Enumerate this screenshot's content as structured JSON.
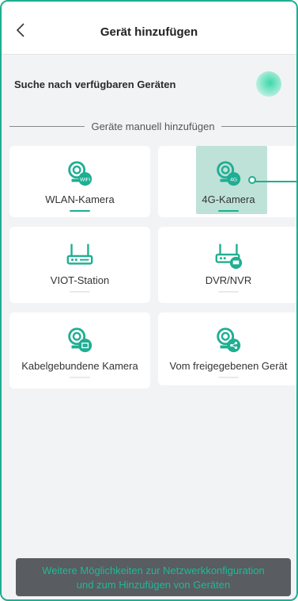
{
  "header": {
    "back_icon": "chevron-left-icon",
    "title": "Gerät hinzufügen"
  },
  "search": {
    "label": "Suche nach verfügbaren Geräten",
    "status_icon": "radar-scan-icon"
  },
  "section": {
    "divider_label": "Geräte manuell hinzufügen"
  },
  "devices": [
    {
      "label": "WLAN-Kamera",
      "icon": "wifi-camera-icon"
    },
    {
      "label": "4G-Kamera",
      "icon": "4g-camera-icon",
      "highlighted": true
    },
    {
      "label": "VIOT-Station",
      "icon": "station-icon"
    },
    {
      "label": "DVR/NVR",
      "icon": "dvr-nvr-icon"
    },
    {
      "label": "Kabelgebundene Kamera",
      "icon": "wired-camera-icon"
    },
    {
      "label": "Vom freigegebenen Gerät",
      "icon": "shared-camera-icon"
    }
  ],
  "footer": {
    "line1": "Weitere Möglichkeiten zur Netzwerkkonfiguration",
    "line2": "und zum Hinzufügen von Geräten"
  },
  "colors": {
    "accent": "#1fae92",
    "background": "#f2f3f5",
    "footer_bg": "#595c60"
  }
}
